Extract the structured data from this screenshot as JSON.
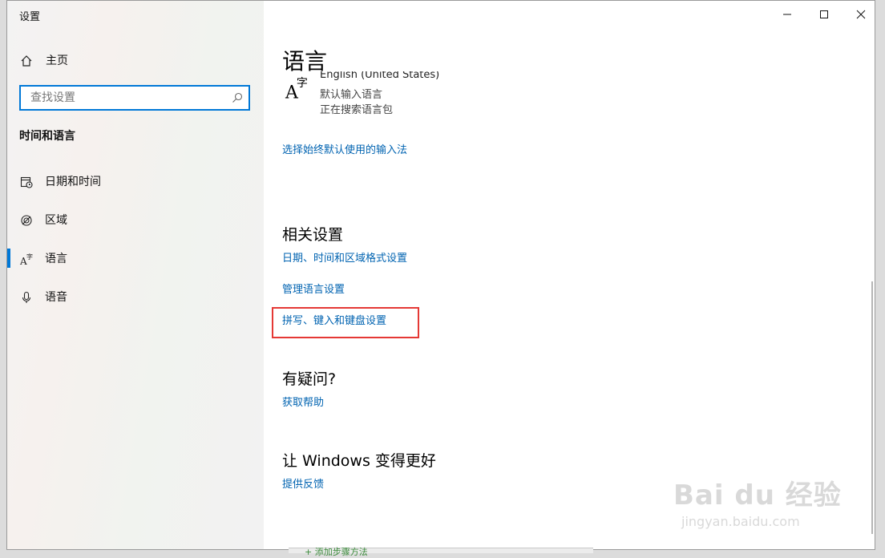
{
  "app": {
    "title": "设置"
  },
  "window_controls": {
    "minimize_icon": "minimize-icon",
    "maximize_icon": "maximize-icon",
    "close_icon": "close-icon"
  },
  "sidebar": {
    "home_label": "主页",
    "search": {
      "placeholder": "查找设置",
      "value": ""
    },
    "section_title": "时间和语言",
    "items": [
      {
        "label": "日期和时间",
        "icon": "calendar-clock-icon",
        "selected": false
      },
      {
        "label": "区域",
        "icon": "globe-icon",
        "selected": false
      },
      {
        "label": "语言",
        "icon": "language-icon",
        "selected": true
      },
      {
        "label": "语音",
        "icon": "microphone-icon",
        "selected": false
      }
    ]
  },
  "main": {
    "page_title": "语言",
    "language_entry": {
      "name": "English (United States)",
      "line1": "默认输入语言",
      "line2": "正在搜索语言包"
    },
    "input_method_link": "选择始终默认使用的输入法",
    "related": {
      "heading": "相关设置",
      "links": [
        "日期、时间和区域格式设置",
        "管理语言设置",
        "拼写、键入和键盘设置"
      ]
    },
    "questions": {
      "heading": "有疑问?",
      "link": "获取帮助"
    },
    "improve": {
      "heading": "让 Windows 变得更好",
      "link": "提供反馈"
    }
  },
  "watermark": {
    "brand": "Bai du 经验",
    "url": "jingyan.baidu.com"
  },
  "bottom_text": "+ 添加步骤方法",
  "colors": {
    "accent": "#0078d7",
    "link": "#0063b1",
    "highlight": "#e53935"
  }
}
